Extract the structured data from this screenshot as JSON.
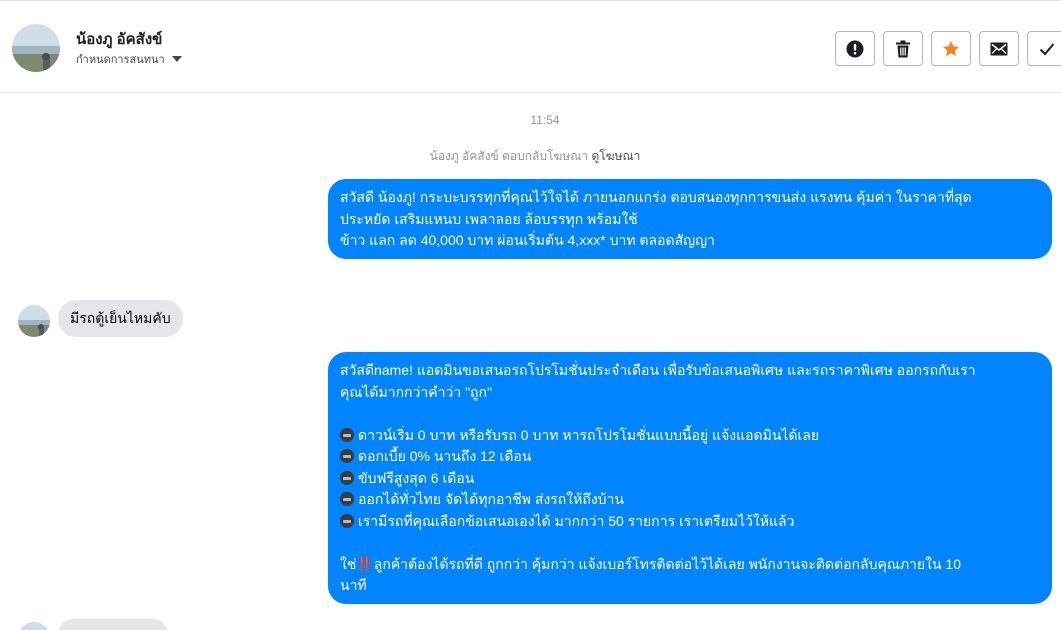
{
  "header": {
    "contact_name": "น้องภู อัคสังข์",
    "assign_label": "กำหนดการสนทนา",
    "actions": [
      "mark-spam",
      "delete",
      "star",
      "mark-unread",
      "done"
    ],
    "star_color": "#f5821f"
  },
  "conversation": {
    "timestamp": "11:54",
    "reply_note": "น้องภู อัคสังข์ ตอบกลับโฆษณา",
    "reply_link": "ดูโฆษณา",
    "message_1": {
      "lines": [
        "สวัสดี น้องภู! กระบะบรรทุกที่คุณไว้ใจได้ ภายนอกแกร่ง ตอบสนองทุกการขนส่ง แรงทน คุ้มค่า ในราคาที่สุด",
        "ประหยัด เสริมแหนบ เพลาลอย ล้อบรรทุก พร้อมใช้",
        "ข้าว แลก ลด 40,000 บาท ผ่อนเริ่มต้น 4,xxx* บาท ตลอดสัญญา"
      ]
    },
    "incoming_1": "มีรถตู้เย็นไหมคับ",
    "message_2": {
      "intro_lines": [
        "สวัสดีname! แอดมินขอเสนอรถโปรโมชั่นประจำเดือน เพื่อรับข้อเสนอพิเศษ และรถราคาพิเศษ ออกรถกับเรา",
        "คุณได้มากกว่าคำว่า \"ถูก\""
      ],
      "bullets": [
        "ดาวน์เริ่ม 0 บาท หรือรับรถ 0 บาท หารถโปรโมชั่นแบบนี้อยู่ แจ้งแอดมินได้เลย",
        "ดอกเบี้ย 0% นานถึง 12 เดือน",
        "ขับฟรีสูงสุด 6 เดือน",
        "ออกได้ทั่วไทย จัดได้ทุกอาชีพ ส่งรถให้ถึงบ้าน",
        "เรามีรถที่คุณเลือกข้อเสนอเองได้ มากกว่า 50 รายการ เราเตรียมไว้ให้แล้ว"
      ],
      "closing_prefix": "ใช่",
      "closing_mark": "‼️",
      "closing_line_1": "ลูกค้าต้องได้รถที่ดี ถูกกว่า คุ้มกว่า แจ้งเบอร์โทรติดต่อไว้ได้เลย พนักงานจะติดต่อกลับคุณภายใน 10",
      "closing_line_2": "นาที"
    }
  },
  "colors": {
    "outgoing_bubble": "#0084ff",
    "incoming_bubble": "#e4e6eb",
    "meta_text": "#90949c"
  }
}
